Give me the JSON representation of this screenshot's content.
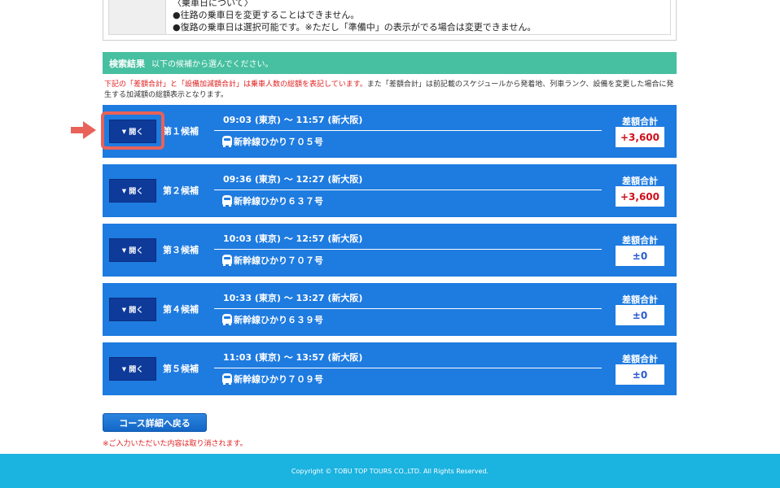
{
  "info": {
    "lines": [
      "〈乗車日について〉",
      "●往路の乗車日を変更することはできません。",
      "●復路の乗車日は選択可能です。※ただし「準備中」の表示がでる場合は変更できません。"
    ]
  },
  "result": {
    "title": "検索結果",
    "subtitle": "以下の候補から選んでください。"
  },
  "note": {
    "red1": "下記の「差額合計」と「設備加減額合計」は乗車人数の総額を表記しています。",
    "text": "また「差額合計」は前記載のスケジュールから発着地、列車ランク、設備を変更した場合に発生する加減額の総額表示となります。"
  },
  "candidates": [
    {
      "open_label": "開く",
      "label": "第１候補",
      "time": "09:03 (東京) ～ 11:57 (新大阪)",
      "train": "新幹線ひかり７０５号",
      "diff_title": "差額合計",
      "diff": "+3,600",
      "diff_color": "#d0101a"
    },
    {
      "open_label": "開く",
      "label": "第２候補",
      "time": "09:36 (東京) ～ 12:27 (新大阪)",
      "train": "新幹線ひかり６３７号",
      "diff_title": "差額合計",
      "diff": "+3,600",
      "diff_color": "#d0101a"
    },
    {
      "open_label": "開く",
      "label": "第３候補",
      "time": "10:03 (東京) ～ 12:57 (新大阪)",
      "train": "新幹線ひかり７０７号",
      "diff_title": "差額合計",
      "diff": "±0",
      "diff_color": "#2a5bd0"
    },
    {
      "open_label": "開く",
      "label": "第４候補",
      "time": "10:33 (東京) ～ 13:27 (新大阪)",
      "train": "新幹線ひかり６３９号",
      "diff_title": "差額合計",
      "diff": "±0",
      "diff_color": "#2a5bd0"
    },
    {
      "open_label": "開く",
      "label": "第５候補",
      "time": "11:03 (東京) ～ 13:57 (新大阪)",
      "train": "新幹線ひかり７０９号",
      "diff_title": "差額合計",
      "diff": "±0",
      "diff_color": "#2a5bd0"
    }
  ],
  "back_button": "コース詳細へ戻る",
  "cancel_note": "※ご入力いただいた内容は取り消されます。",
  "footer": "Copyright © TOBU TOP TOURS CO.,LTD. All Rights Reserved.",
  "colors": {
    "card": "#1e7be0",
    "header": "#46c0a0",
    "footer": "#1bb3e0",
    "highlight": "#e8625a"
  }
}
